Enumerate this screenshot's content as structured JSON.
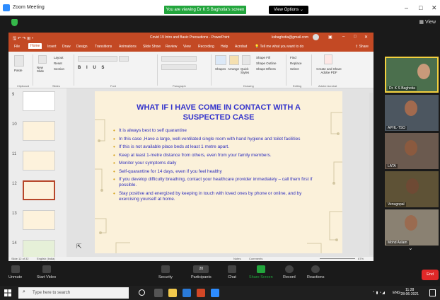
{
  "window": {
    "title": "Zoom Meeting",
    "banner": "You are viewing Dr K S Baghotia's screen",
    "view_options": "View Options"
  },
  "view_label": "View",
  "powerpoint": {
    "title": "Covid 19 Intro and Basic Precautions - PowerPoint",
    "user": "ksbaghotia@gmail.com",
    "tabs": [
      "File",
      "Home",
      "Insert",
      "Draw",
      "Design",
      "Transitions",
      "Animations",
      "Slide Show",
      "Review",
      "View",
      "Recording",
      "Help",
      "Acrobat"
    ],
    "tell_me": "Tell me what you want to do",
    "share": "Share",
    "ribbon_groups": [
      "Clipboard",
      "Slides",
      "Font",
      "Paragraph",
      "Drawing",
      "Editing",
      "Adobe Acrobat"
    ],
    "ribbon_labels": {
      "paste": "Paste",
      "new_slide": "New Slide",
      "layout": "Layout",
      "reset": "Reset",
      "section": "Section",
      "shapes": "Shapes",
      "arrange": "Arrange",
      "quick_styles": "Quick Styles",
      "shape_fill": "Shape Fill",
      "shape_outline": "Shape Outline",
      "shape_effects": "Shape Effects",
      "find": "Find",
      "replace": "Replace",
      "select": "Select",
      "create_share": "Create and Share Adobe PDF"
    },
    "thumb_numbers": [
      "9",
      "10",
      "11",
      "12",
      "13",
      "14"
    ],
    "slide": {
      "title": "WHAT IF I HAVE COME IN CONTACT WITH A SUSPECTED CASE",
      "bullets": [
        "It is always best to self quarantine",
        "In this case ,Have a large, well-ventilated single room with hand hygiene and toilet facilities",
        "If this is not available place beds at least 1 metre apart.",
        "Keep at least 1-metre distance from others, even from your family members.",
        "Monitor your symptoms daily",
        "Self-quarantine for 14 days, even if you feel healthy",
        "If you develop difficulty breathing, contact your healthcare provider immediately – call them first if possible.",
        "Stay positive and energized by keeping in touch with loved ones by phone or online, and by exercising yourself at home."
      ]
    },
    "status_left": "Slide 12 of 32",
    "status_lang": "English (India)",
    "status_notes": "Notes",
    "status_comments": "Comments",
    "zoom_pct": "67%"
  },
  "participants": [
    {
      "name": "Dr. K S Baghotia"
    },
    {
      "name": "APHL-TSO"
    },
    {
      "name": "LATA"
    },
    {
      "name": "Venugopal"
    },
    {
      "name": "Mohd Aslam"
    }
  ],
  "controls": {
    "unmute": "Unmute",
    "start_video": "Start Video",
    "security": "Security",
    "participants": "Participants",
    "participants_count": "20",
    "chat": "Chat",
    "share_screen": "Share Screen",
    "record": "Record",
    "reactions": "Reactions",
    "end": "End"
  },
  "taskbar": {
    "search_placeholder": "Type here to search",
    "lang": "ENG",
    "time": "11:28",
    "date": "28-06-2021"
  },
  "colors": {
    "ppt_accent": "#c34924",
    "slide_text": "#2f2fbd",
    "slide_bg": "#fbf1da",
    "zoom_green": "#22a53c",
    "end_red": "#e02828"
  }
}
